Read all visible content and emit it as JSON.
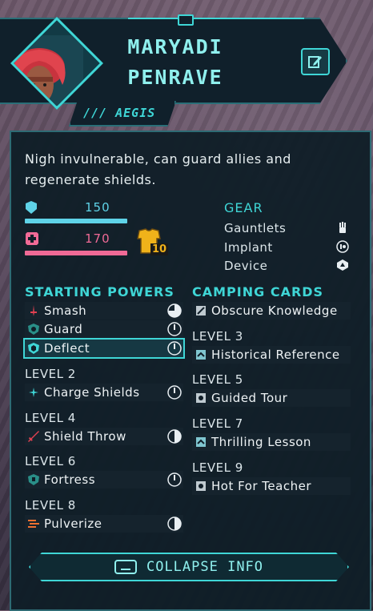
{
  "character": {
    "first_name": "MARYADI",
    "last_name": "PENRAVE",
    "class_tag": "/// AEGIS"
  },
  "description": "Nigh invulnerable, can guard allies and regenerate shields.",
  "stats": {
    "shield": {
      "value": "150",
      "color": "#5fd3e8",
      "fill": 1.0
    },
    "health": {
      "value": "170",
      "color": "#f06a96",
      "fill": 1.0
    },
    "armor_badge": "10"
  },
  "gear": {
    "title": "GEAR",
    "items": [
      {
        "label": "Gauntlets",
        "icon": "gauntlet-icon"
      },
      {
        "label": "Implant",
        "icon": "implant-icon"
      },
      {
        "label": "Device",
        "icon": "device-icon"
      }
    ]
  },
  "powers": {
    "title": "STARTING POWERS",
    "starting": [
      {
        "label": "Smash",
        "icon": "smash-icon",
        "cooldown": "three-quarter"
      },
      {
        "label": "Guard",
        "icon": "guard-icon",
        "cooldown": "clock"
      },
      {
        "label": "Deflect",
        "icon": "deflect-icon",
        "cooldown": "clock",
        "selected": true
      }
    ],
    "levels": [
      {
        "level": "LEVEL 2",
        "label": "Charge Shields",
        "icon": "charge-shields-icon",
        "cooldown": "clock"
      },
      {
        "level": "LEVEL 4",
        "label": "Shield Throw",
        "icon": "shield-throw-icon",
        "cooldown": "half"
      },
      {
        "level": "LEVEL 6",
        "label": "Fortress",
        "icon": "fortress-icon",
        "cooldown": "clock"
      },
      {
        "level": "LEVEL 8",
        "label": "Pulverize",
        "icon": "pulverize-icon",
        "cooldown": "half"
      }
    ]
  },
  "camping": {
    "title": "CAMPING CARDS",
    "first": {
      "label": "Obscure Knowledge",
      "icon": "card-icon"
    },
    "levels": [
      {
        "level": "LEVEL 3",
        "label": "Historical Reference"
      },
      {
        "level": "LEVEL 5",
        "label": "Guided Tour"
      },
      {
        "level": "LEVEL 7",
        "label": "Thrilling Lesson"
      },
      {
        "level": "LEVEL 9",
        "label": "Hot For Teacher"
      }
    ]
  },
  "collapse_button": "COLLAPSE INFO",
  "colors": {
    "accent": "#3fd6d6",
    "panel": "#101e28",
    "shield": "#5fd3e8",
    "health": "#f06a96",
    "armor": "#f0b21a"
  }
}
